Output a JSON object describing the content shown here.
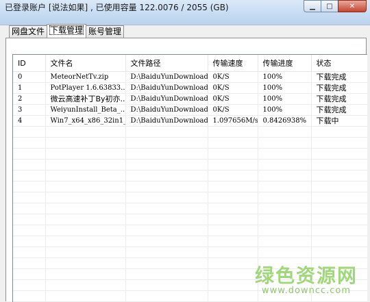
{
  "window": {
    "title": "已登录账户 [说法如果] , 已使用容量 122.0076 / 2055 (GB)",
    "controls": {
      "minimize": "▁",
      "maximize": "□",
      "close": "✕"
    }
  },
  "tabs": [
    {
      "label": "网盘文件",
      "active": false
    },
    {
      "label": "下载管理",
      "active": true
    },
    {
      "label": "账号管理",
      "active": false
    }
  ],
  "table": {
    "columns": [
      "ID",
      "文件名",
      "文件路径",
      "传输速度",
      "传输进度",
      "状态"
    ],
    "rows": [
      [
        "0",
        "MeteorNetTv.zip",
        "D:\\BaiduYunDownload...",
        "0K/S",
        "100%",
        "下载完成"
      ],
      [
        "1",
        "PotPlayer 1.6.63833...",
        "D:\\BaiduYunDownload...",
        "0K/S",
        "100%",
        "下载完成"
      ],
      [
        "2",
        "微云高速补丁By初亦...",
        "D:\\BaiduYunDownload...",
        "0K/S",
        "100%",
        "下载完成"
      ],
      [
        "3",
        "WeiyunInstall_Beta_...",
        "D:\\BaiduYunDownload...",
        "0K/S",
        "100%",
        "下载完成"
      ],
      [
        "4",
        "Win7_x64_x86_32in1_...",
        "D:\\BaiduYunDownload...",
        "1.097656M/s",
        "0.8426938%",
        "下载中"
      ]
    ]
  },
  "watermark": {
    "text": "绿色资源网",
    "url": "www.downcc.com"
  },
  "colors": {
    "titlebar": "#c7dcf2",
    "watermark": "#9fd77a",
    "close_button": "#c4452f"
  }
}
